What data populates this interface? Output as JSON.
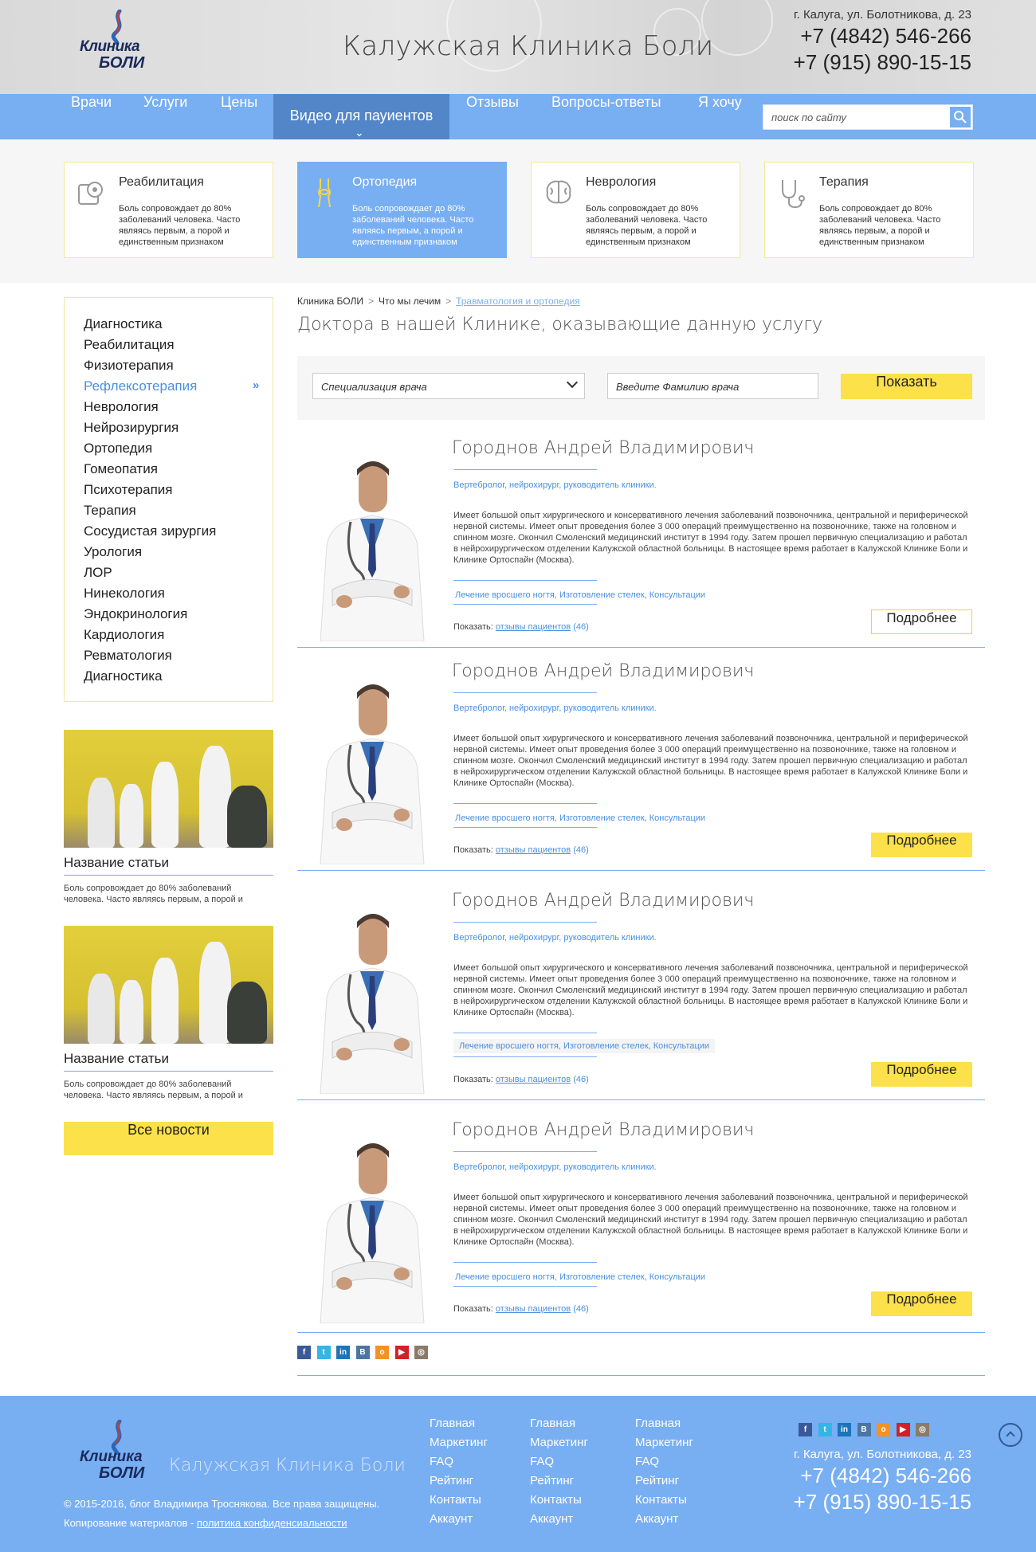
{
  "header": {
    "logo_line1": "Клиника",
    "logo_line2": "БОЛИ",
    "site_title": "Калужская Клиника Боли",
    "address": "г. Калуга, ул. Болотникова, д. 23",
    "phone1": "+7 (4842) 546-266",
    "phone2": "+7 (915) 890-15-15"
  },
  "nav": {
    "items": [
      "Врачи",
      "Услуги",
      "Цены",
      "Видео для пауиентов",
      "Отзывы",
      "Вопросы-ответы",
      "Я хочу"
    ],
    "active_index": 3,
    "search_placeholder": "поиск по сайту"
  },
  "categories": [
    {
      "title": "Реабилитация",
      "text": "Боль сопровождает до 80% заболеваний человека. Часто являясь первым, а порой и единственным признаком",
      "icon": "bandage-icon"
    },
    {
      "title": "Ортопедия",
      "text": "Боль сопровождает до 80% заболеваний человека. Часто являясь первым, а порой и единственным признаком",
      "icon": "knee-joint-icon",
      "active": true
    },
    {
      "title": "Неврология",
      "text": "Боль сопровождает до 80% заболеваний человека. Часто являясь первым, а порой и единственным признаком",
      "icon": "brain-icon"
    },
    {
      "title": "Терапия",
      "text": "Боль сопровождает до 80% заболеваний человека. Часто являясь первым, а порой и единственным признаком",
      "icon": "stethoscope-icon"
    }
  ],
  "sidebar": {
    "items": [
      "Диагностика",
      "Реабилитация",
      "Физиотерапия",
      "Рефлексотерапия",
      "Неврология",
      "Нейрозирургия",
      "Ортопедия",
      "Гомеопатия",
      "Психотерапия",
      "Терапия",
      "Сосудистая зирургия",
      "Урология",
      "ЛОР",
      "Нинекология",
      "Эндокринология",
      "Кардиология",
      "Ревматология",
      "Диагностика"
    ],
    "active_index": 3
  },
  "news": [
    {
      "title": "Название статьи",
      "text": "Боль сопровождает до 80% заболеваний человека. Часто являясь первым, а порой и"
    },
    {
      "title": "Название статьи",
      "text": "Боль сопровождает до 80% заболеваний человека. Часто являясь первым, а порой и"
    }
  ],
  "all_news_label": "Все новости",
  "breadcrumb": [
    "Клиника БОЛИ",
    "Что мы лечим",
    "Травматология и ортопедия"
  ],
  "breadcrumb_separator": ">",
  "main_title": "Доктора в нашей Клинике, оказывающие данную услугу",
  "filter": {
    "spec_placeholder": "Специализация врача",
    "name_placeholder": "Введите Фамилию врача",
    "show_label": "Показать"
  },
  "doctors": [
    {
      "name": "Городнов Андрей Владимирович",
      "spec": "Вертебролог, нейрохирург, руководитель клиники.",
      "desc": "Имеет большой опыт хирургического и консервативного лечения заболеваний позвоночника, центральной и периферической нервной системы. Имеет опыт проведения более 3 000 операций преимущественно на позвоночнике, также на головном и спинном мозге. Окончил Смоленский медицинский институт в 1994 году. Затем прошел первичную специализацию и работал в нейрохирургическом отделении  Калужской областной больницы. В настоящее время работает в Калужской Клинике Боли и Клинике Ортоспайн (Москва).",
      "services": "Лечение вросшего ногтя, Изготовление стелек, Консультации",
      "show_label": "Показать:",
      "reviews_label": "отзывы пациентов",
      "reviews_count": "(46)",
      "button": "Подробнее"
    },
    {
      "name": "Городнов Андрей Владимирович",
      "spec": "Вертебролог, нейрохирург, руководитель клиники.",
      "desc": "Имеет большой опыт хирургического и консервативного лечения заболеваний позвоночника, центральной и периферической нервной системы. Имеет опыт проведения более 3 000 операций преимущественно на позвоночнике, также на головном и спинном мозге. Окончил Смоленский медицинский институт в 1994 году. Затем прошел первичную специализацию и работал в нейрохирургическом отделении  Калужской областной больницы. В настоящее время работает в Калужской Клинике Боли и Клинике Ортоспайн (Москва).",
      "services": "Лечение вросшего ногтя, Изготовление стелек, Консультации",
      "show_label": "Показать:",
      "reviews_label": "отзывы пациентов",
      "reviews_count": "(46)",
      "button": "Подробнее"
    },
    {
      "name": "Городнов Андрей Владимирович",
      "spec": "Вертебролог, нейрохирург, руководитель клиники.",
      "desc": "Имеет большой опыт хирургического и консервативного лечения заболеваний позвоночника, центральной и периферической нервной системы. Имеет опыт проведения более 3 000 операций преимущественно на позвоночнике, также на головном и спинном мозге. Окончил Смоленский медицинский институт в 1994 году. Затем прошел первичную специализацию и работал в нейрохирургическом отделении  Калужской областной больницы. В настоящее время работает в Калужской Клинике Боли и Клинике Ортоспайн (Москва).",
      "services": "Лечение вросшего ногтя, Изготовление стелек, Консультации",
      "show_label": "Показать:",
      "reviews_label": "отзывы пациентов",
      "reviews_count": "(46)",
      "button": "Подробнее"
    },
    {
      "name": "Городнов Андрей Владимирович",
      "spec": "Вертебролог, нейрохирург, руководитель клиники.",
      "desc": "Имеет большой опыт хирургического и консервативного лечения заболеваний позвоночника, центральной и периферической нервной системы. Имеет опыт проведения более 3 000 операций преимущественно на позвоночнике, также на головном и спинном мозге. Окончил Смоленский медицинский институт в 1994 году. Затем прошел первичную специализацию и работал в нейрохирургическом отделении  Калужской областной больницы. В настоящее время работает в Калужской Клинике Боли и Клинике Ортоспайн (Москва).",
      "services": "Лечение вросшего ногтя, Изготовление стелек, Консультации",
      "show_label": "Показать:",
      "reviews_label": "отзывы пациентов",
      "reviews_count": "(46)",
      "button": "Подробнее"
    }
  ],
  "social": [
    {
      "icon": "facebook-icon",
      "glyph": "f",
      "color": "#3b5998"
    },
    {
      "icon": "twitter-icon",
      "glyph": "t",
      "color": "#33b5e5"
    },
    {
      "icon": "linkedin-icon",
      "glyph": "in",
      "color": "#1b75bb"
    },
    {
      "icon": "vk-icon",
      "glyph": "В",
      "color": "#4c75a3"
    },
    {
      "icon": "odnoklassniki-icon",
      "glyph": "о",
      "color": "#f4931f"
    },
    {
      "icon": "youtube-icon",
      "glyph": "▶",
      "color": "#d32027"
    },
    {
      "icon": "instagram-icon",
      "glyph": "◎",
      "color": "#8a7a6a"
    }
  ],
  "footer": {
    "title": "Калужская Клиника Боли",
    "copyright": "© 2015-2016, блог Владимира Троснякова. Все права защищены.",
    "copy_prefix": "Копирование материалов -",
    "policy_link": "политика конфиденсиальности",
    "columns": [
      [
        "Главная",
        "Маркетинг",
        "FAQ",
        "Рейтинг",
        "Контакты",
        "Аккаунт"
      ],
      [
        "Главная",
        "Маркетинг",
        "FAQ",
        "Рейтинг",
        "Контакты",
        "Аккаунт"
      ],
      [
        "Главная",
        "Маркетинг",
        "FAQ",
        "Рейтинг",
        "Контакты",
        "Аккаунт"
      ]
    ],
    "address": "г. Калуга, ул. Болотникова, д. 23",
    "phone1": "+7 (4842) 546-266",
    "phone2": "+7 (915) 890-15-15"
  },
  "colors": {
    "accent": "#78aef2",
    "yellow": "#fde14b",
    "link": "#4a8fe0"
  }
}
